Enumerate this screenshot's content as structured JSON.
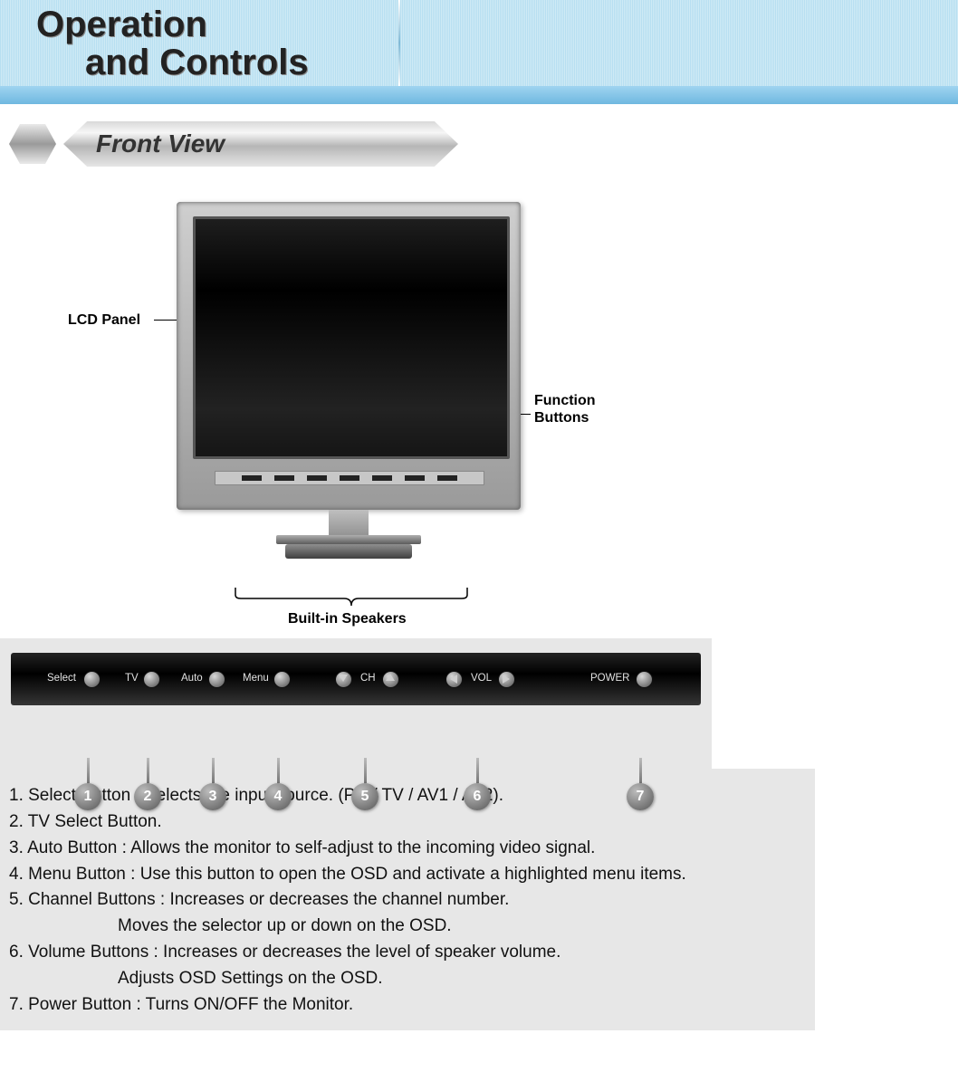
{
  "header": {
    "title_line1": "Operation",
    "title_line2": "and Controls"
  },
  "section": {
    "title": "Front View"
  },
  "diagram": {
    "lcd_label": "LCD Panel",
    "function_label_l1": "Function",
    "function_label_l2": "Buttons",
    "speakers_label": "Built-in Speakers"
  },
  "panel": {
    "buttons": {
      "select": "Select",
      "tv": "TV",
      "auto": "Auto",
      "menu": "Menu",
      "ch": "CH",
      "vol": "VOL",
      "power": "POWER"
    },
    "numbers": {
      "n1": "1",
      "n2": "2",
      "n3": "3",
      "n4": "4",
      "n5": "5",
      "n6": "6",
      "n7": "7"
    }
  },
  "desc": {
    "l1": "1. Select Button : Selects the input source. (PC / TV / AV1 / AV2).",
    "l2": "2. TV Select Button.",
    "l3": "3. Auto Button : Allows the monitor to self-adjust to the incoming video signal.",
    "l4": "4. Menu Button : Use this button to open the OSD and activate a highlighted menu items.",
    "l5": "5. Channel Buttons : Increases or decreases the channel number.",
    "l5b": "Moves the selector up or down on the OSD.",
    "l6": "6. Volume Buttons : Increases or decreases the level of speaker volume.",
    "l6b": "Adjusts OSD Settings on the OSD.",
    "l7": "7. Power Button : Turns ON/OFF the Monitor."
  }
}
